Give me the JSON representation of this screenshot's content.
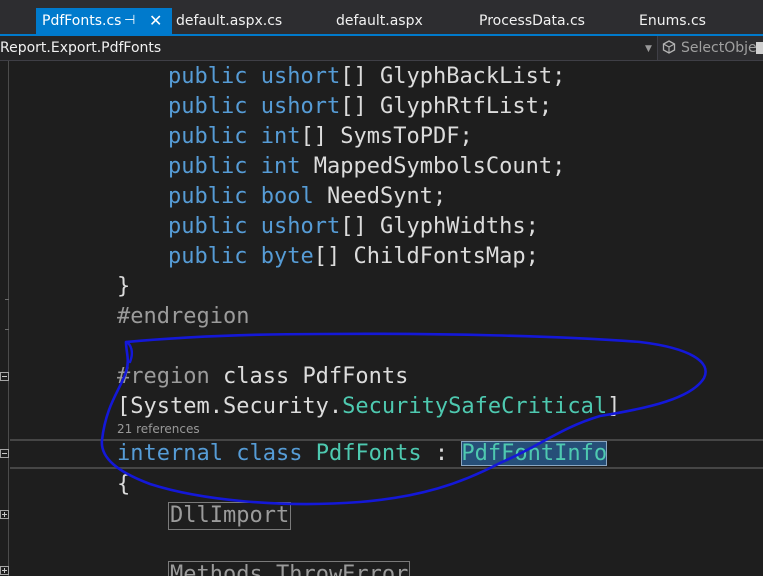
{
  "tabs": [
    {
      "label": "PdfFonts.cs",
      "active": true
    },
    {
      "label": "default.aspx.cs",
      "active": false
    },
    {
      "label": "default.aspx",
      "active": false
    },
    {
      "label": "ProcessData.cs",
      "active": false
    },
    {
      "label": "Enums.cs",
      "active": false
    }
  ],
  "tab_icons": {
    "pin": "pin-icon",
    "close": "close-icon"
  },
  "navbar": {
    "left_text": "Report.Export.PdfFonts",
    "right_text": "SelectObjec"
  },
  "code": {
    "fields": [
      {
        "type": "ushort",
        "array": "[]",
        "name": "GlyphBackList"
      },
      {
        "type": "ushort",
        "array": "[]",
        "name": "GlyphRtfList"
      },
      {
        "type": "int",
        "array": "[]",
        "name": "SymsToPDF"
      },
      {
        "type": "int",
        "array": "",
        "name": "MappedSymbolsCount"
      },
      {
        "type": "bool",
        "array": "",
        "name": "NeedSynt"
      },
      {
        "type": "ushort",
        "array": "[]",
        "name": "GlyphWidths"
      },
      {
        "type": "byte",
        "array": "[]",
        "name": "ChildFontsMap"
      }
    ],
    "public_kw": "public",
    "close_brace": "}",
    "open_brace": "{",
    "endregion": "#endregion",
    "region_kw": "#region",
    "region_name": "class PdfFonts",
    "attr_open": "[",
    "attr_ns": "System.Security.",
    "attr_type": "SecuritySafeCritical",
    "attr_close": "]",
    "codelens": "21 references",
    "internal_kw": "internal",
    "class_kw": "class",
    "class_name": "PdfFonts",
    "colon": " : ",
    "base_class": "PdfFontInfo",
    "collapsed1": "DllImport",
    "collapsed2": "Methods ThrowError"
  },
  "colors": {
    "keyword": "#569cd6",
    "type": "#4ec9b0",
    "plain": "#dcdcdc",
    "accent": "#007acc",
    "annotation": "#1418d8"
  }
}
